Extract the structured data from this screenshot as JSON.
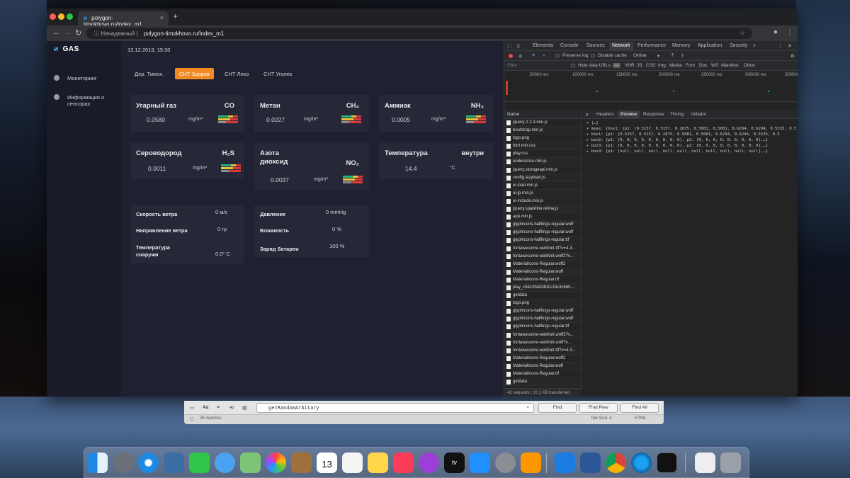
{
  "browser": {
    "tab_title": "polygon-timokhovo.ru/index_m1",
    "tab_close": "×",
    "new_tab": "+",
    "security_label": "Ненадежный",
    "url": "polygon-timokhovo.ru/index_m1"
  },
  "app": {
    "logo": "GAS",
    "sidebar": [
      {
        "label": "Мониторинг"
      },
      {
        "label": "Информация о сенсорах"
      }
    ],
    "datetime": "13.12.2019, 15:30",
    "tabs": [
      "Дер. Тимох.",
      "СНТ Здоров",
      "СНТ Локо",
      "СНТ Уголек"
    ],
    "active_tab": 1,
    "sensors": [
      {
        "name": "Угарный газ",
        "formula": "CO",
        "value": "0.0580",
        "unit": "mg/m³"
      },
      {
        "name": "Метан",
        "formula": "CH₄",
        "value": "0.0227",
        "unit": "mg/m³"
      },
      {
        "name": "Аммиак",
        "formula": "NH₃",
        "value": "0.0005",
        "unit": "mg/m³"
      },
      {
        "name": "Сероводород",
        "formula": "H₂S",
        "value": "0.0011",
        "unit": "mg/m³"
      },
      {
        "name": "Азота диоксид",
        "formula": "NO₂",
        "value": "0.0037",
        "unit": "mg/m³"
      },
      {
        "name": "Температура",
        "formula": "внутри",
        "value": "14.4",
        "unit": "°C"
      }
    ],
    "weather": [
      {
        "label": "Скорость ветра",
        "value": "0 м/с"
      },
      {
        "label": "Направление ветра",
        "value": "0 гр"
      },
      {
        "label": "Температура снаружи",
        "value": "0.0° C"
      }
    ],
    "station": [
      {
        "label": "Давление",
        "value": "0 mmHg"
      },
      {
        "label": "Влажность",
        "value": "0 %"
      },
      {
        "label": "Заряд батареи",
        "value": "100 %"
      }
    ]
  },
  "devtools": {
    "tabs": [
      "Elements",
      "Console",
      "Sources",
      "Network",
      "Performance",
      "Memory",
      "Application",
      "Security"
    ],
    "active_tab": "Network",
    "more": "»",
    "controls": {
      "preserve_log": "Preserve log",
      "disable_cache": "Disable cache",
      "throttle": "Online"
    },
    "filter": {
      "placeholder": "Filter",
      "hide_data_urls": "Hide data URLs",
      "types": [
        "All",
        "XHR",
        "JS",
        "CSS",
        "Img",
        "Media",
        "Font",
        "Doc",
        "WS",
        "Manifest",
        "Other"
      ]
    },
    "timeline_labels": [
      "50000 ms",
      "100000 ms",
      "150000 ms",
      "200000 ms",
      "250000 ms",
      "300000 ms",
      "350000"
    ],
    "name_header": "Name",
    "files": [
      "jquery-2.2.3.min.js",
      "bootstrap.min.js",
      "logo.png",
      "font.min.css",
      "play.css",
      "underscore-min.js",
      "jquery.storageapi.min.js",
      "config.lazyload.js",
      "ui-load.min.js",
      "ui-jp.min.js",
      "ui-include.min.js",
      "jquery.sparkline.retina.js",
      "app.min.js",
      "glyphicons-halflings-regular.woff",
      "glyphicons-halflings-regular.woff",
      "glyphicons-halflings-regular.ttf",
      "fontawesome-webfont.ttf?v=4.3...",
      "fontawesome-webfont.woff2?v...",
      "MaterialIcons-Regular.woff2",
      "MaterialIcons-Regular.woff",
      "MaterialIcons-Regular.ttf",
      "play_c5419fa924b1c1bc3c6b0...",
      "getdata",
      "logo.png",
      "glyphicons-halflings-regular.woff",
      "glyphicons-halflings-regular.woff",
      "glyphicons-halflings-regular.ttf",
      "fontawesome-webfont.woff2?v...",
      "fontawesome-webfont.woff?v...",
      "fontawesome-webfont.ttf?v=4.3...",
      "MaterialIcons-Regular.woff2",
      "MaterialIcons-Regular.woff",
      "MaterialIcons-Regular.ttf",
      "getdata"
    ],
    "footer": "42 requests | 10.1 KB transferred",
    "preview_tabs": [
      "Headers",
      "Preview",
      "Response",
      "Timing",
      "Initiator"
    ],
    "active_preview": "Preview",
    "json_lines": [
      "▾ {…}",
      "  ▾ meas: {box1: {p1: [0.5157, 0.5157, 0.2875, 0.5081, 0.5081, 0.6294, 0.6294, 0.5535, 0.5",
      "    ▸ box1: {p1: [0.5157, 0.5157, 0.2875, 0.5081, 0.5081, 0.6294, 0.6294, 0.5535, 0.5",
      "    ▸ box2: {p1: [0, 0, 0, 0, 0, 0, 0, 0, 0], p2: [0, 0, 0, 0, 0, 0, 0, 0, 0],…}",
      "    ▸ box3: {p1: [0, 0, 0, 0, 0, 0, 0, 0, 0], p2: [0, 0, 0, 0, 0, 0, 0, 0, 0],…}",
      "    ▸ box4: {p1: [null, null, null, null, null, null, null, null, null, null],…}"
    ]
  },
  "findbar": {
    "aa": "Aa",
    "query": "getRandomArbitary",
    "find": "Find",
    "find_prev": "Find Prev",
    "find_all": "Find All",
    "matches": "26 matches",
    "tab_size": "Tab Size: 4",
    "syntax": "HTML"
  },
  "dock": {
    "calendar_day": "13",
    "tv_label": "tv"
  }
}
